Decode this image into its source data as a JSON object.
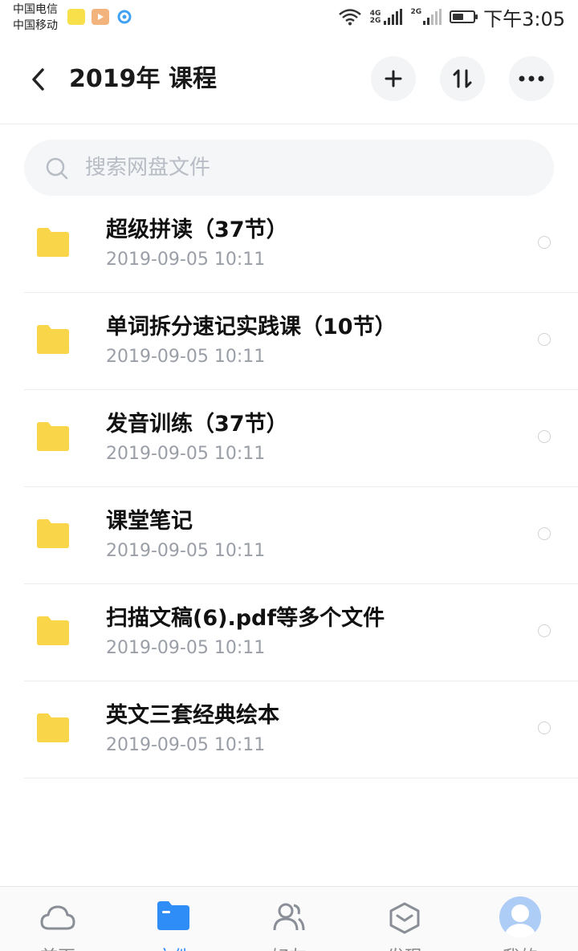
{
  "status_bar": {
    "carrier_1": "中国电信",
    "carrier_2": "中国移动",
    "signal_1_label_top": "4G",
    "signal_1_label_bottom": "2G",
    "signal_2_label": "2G",
    "battery_level": 0.55,
    "time": "下午3:05"
  },
  "header": {
    "title": "2019年 课程"
  },
  "search": {
    "placeholder": "搜索网盘文件"
  },
  "files": [
    {
      "name": "超级拼读（37节）",
      "date": "2019-09-05  10:11"
    },
    {
      "name": "单词拆分速记实践课（10节）",
      "date": "2019-09-05  10:11"
    },
    {
      "name": "发音训练（37节）",
      "date": "2019-09-05  10:11"
    },
    {
      "name": "课堂笔记",
      "date": "2019-09-05  10:11"
    },
    {
      "name": "扫描文稿(6).pdf等多个文件",
      "date": "2019-09-05  10:11"
    },
    {
      "name": "英文三套经典绘本",
      "date": "2019-09-05  10:11"
    }
  ],
  "bottom_nav": {
    "items": [
      {
        "label": "首页"
      },
      {
        "label": "文件"
      },
      {
        "label": "好友"
      },
      {
        "label": "发现"
      },
      {
        "label": "我的"
      }
    ],
    "active": "文件"
  },
  "colors": {
    "folder": "#f9d549",
    "accent": "#2f8df7"
  }
}
